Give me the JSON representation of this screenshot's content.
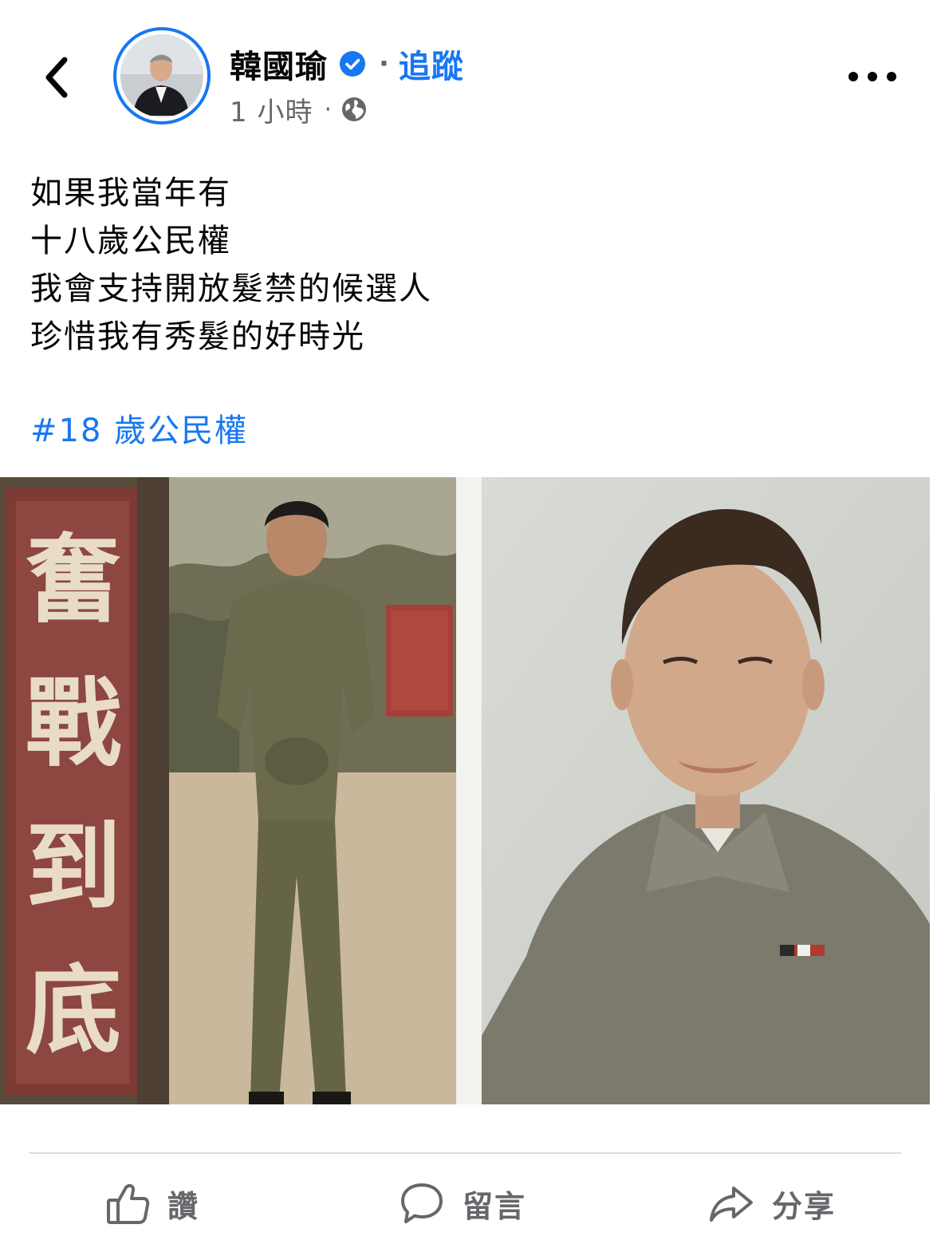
{
  "post": {
    "author": "韓國瑜",
    "separator": "·",
    "follow_label": "追蹤",
    "time": "1 小時",
    "meta_separator": "·",
    "audience_icon": "globe-icon",
    "body_lines": [
      "如果我當年有",
      "十八歲公民權",
      "我會支持開放髮禁的候選人",
      "珍惜我有秀髮的好時光"
    ],
    "hashtag": "#18 歲公民權",
    "photo_sign_text": [
      "奮",
      "戰",
      "到",
      "底"
    ]
  },
  "actions": {
    "like_label": "讚",
    "comment_label": "留言",
    "share_label": "分享"
  },
  "colors": {
    "accent": "#1877f2",
    "secondary_text": "#65676b",
    "divider": "#dcdde1"
  }
}
